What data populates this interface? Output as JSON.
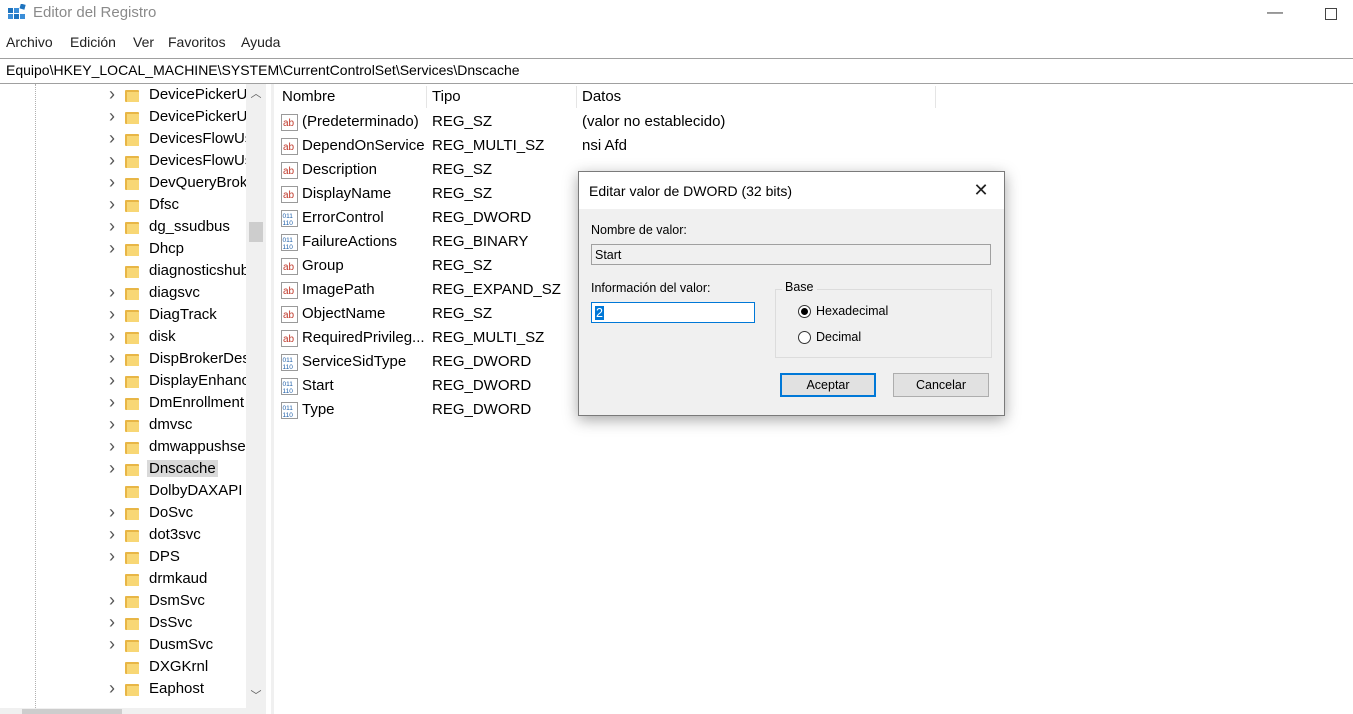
{
  "window": {
    "title": "Editor del Registro",
    "minimize_icon": "minimize-icon",
    "maximize_icon": "maximize-icon"
  },
  "menu": [
    "Archivo",
    "Edición",
    "Ver",
    "Favoritos",
    "Ayuda"
  ],
  "address": "Equipo\\HKEY_LOCAL_MACHINE\\SYSTEM\\CurrentControlSet\\Services\\Dnscache",
  "tree": {
    "items": [
      {
        "label": "DevicePickerUs",
        "expandable": true
      },
      {
        "label": "DevicePickerUs",
        "expandable": true
      },
      {
        "label": "DevicesFlowUs",
        "expandable": true
      },
      {
        "label": "DevicesFlowUs",
        "expandable": true
      },
      {
        "label": "DevQueryBroke",
        "expandable": true
      },
      {
        "label": "Dfsc",
        "expandable": true
      },
      {
        "label": "dg_ssudbus",
        "expandable": true
      },
      {
        "label": "Dhcp",
        "expandable": true
      },
      {
        "label": "diagnosticshub",
        "expandable": false
      },
      {
        "label": "diagsvc",
        "expandable": true
      },
      {
        "label": "DiagTrack",
        "expandable": true
      },
      {
        "label": "disk",
        "expandable": true
      },
      {
        "label": "DispBrokerDes",
        "expandable": true
      },
      {
        "label": "DisplayEnhanc",
        "expandable": true
      },
      {
        "label": "DmEnrollment",
        "expandable": true
      },
      {
        "label": "dmvsc",
        "expandable": true
      },
      {
        "label": "dmwappushser",
        "expandable": true
      },
      {
        "label": "Dnscache",
        "expandable": true,
        "selected": true
      },
      {
        "label": "DolbyDAXAPI",
        "expandable": false
      },
      {
        "label": "DoSvc",
        "expandable": true
      },
      {
        "label": "dot3svc",
        "expandable": true
      },
      {
        "label": "DPS",
        "expandable": true
      },
      {
        "label": "drmkaud",
        "expandable": false
      },
      {
        "label": "DsmSvc",
        "expandable": true
      },
      {
        "label": "DsSvc",
        "expandable": true
      },
      {
        "label": "DusmSvc",
        "expandable": true
      },
      {
        "label": "DXGKrnl",
        "expandable": false
      },
      {
        "label": "Eaphost",
        "expandable": true
      }
    ]
  },
  "list": {
    "columns": [
      "Nombre",
      "Tipo",
      "Datos"
    ],
    "rows": [
      {
        "icon": "string",
        "name": "(Predeterminado)",
        "type": "REG_SZ",
        "data": "(valor no establecido)"
      },
      {
        "icon": "string",
        "name": "DependOnService",
        "type": "REG_MULTI_SZ",
        "data": "nsi Afd"
      },
      {
        "icon": "string",
        "name": "Description",
        "type": "REG_SZ",
        "data": ""
      },
      {
        "icon": "string",
        "name": "DisplayName",
        "type": "REG_SZ",
        "data": ""
      },
      {
        "icon": "binary",
        "name": "ErrorControl",
        "type": "REG_DWORD",
        "data": ""
      },
      {
        "icon": "binary",
        "name": "FailureActions",
        "type": "REG_BINARY",
        "data": ""
      },
      {
        "icon": "string",
        "name": "Group",
        "type": "REG_SZ",
        "data": ""
      },
      {
        "icon": "string",
        "name": "ImagePath",
        "type": "REG_EXPAND_SZ",
        "data": ""
      },
      {
        "icon": "string",
        "name": "ObjectName",
        "type": "REG_SZ",
        "data": ""
      },
      {
        "icon": "string",
        "name": "RequiredPrivileg...",
        "type": "REG_MULTI_SZ",
        "data": ""
      },
      {
        "icon": "binary",
        "name": "ServiceSidType",
        "type": "REG_DWORD",
        "data": ""
      },
      {
        "icon": "binary",
        "name": "Start",
        "type": "REG_DWORD",
        "data": ""
      },
      {
        "icon": "binary",
        "name": "Type",
        "type": "REG_DWORD",
        "data": ""
      }
    ]
  },
  "dialog": {
    "title": "Editar valor de DWORD (32 bits)",
    "close_label": "✕",
    "name_label": "Nombre de valor:",
    "name_value": "Start",
    "data_label": "Información del valor:",
    "data_value": "2",
    "base_label": "Base",
    "radio_hex": "Hexadecimal",
    "radio_dec": "Decimal",
    "base_selected": "Hexadecimal",
    "ok": "Aceptar",
    "cancel": "Cancelar"
  },
  "colors": {
    "accent": "#0078d7",
    "folder": "#f8d775",
    "selection": "#d9d9d9"
  }
}
